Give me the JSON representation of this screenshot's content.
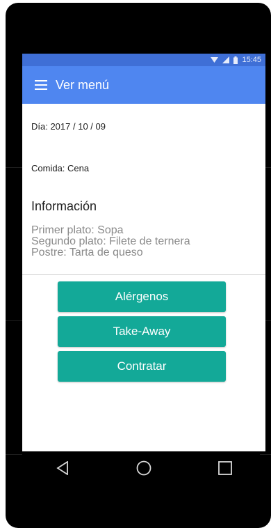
{
  "status": {
    "time": "15:45",
    "wifi_icon": "wifi-icon",
    "signal_icon": "signal-icon",
    "battery_icon": "battery-icon"
  },
  "appbar": {
    "title": "Ver menú",
    "menu_icon": "hamburger-menu-icon"
  },
  "details": {
    "day": "Día: 2017 / 10 / 09",
    "meal": "Comida: Cena"
  },
  "info": {
    "title": "Información",
    "first_course": "Primer plato: Sopa",
    "second_course": "Segundo plato: Filete de ternera",
    "dessert": "Postre: Tarta de queso"
  },
  "buttons": {
    "allergens": "Alérgenos",
    "takeaway": "Take-Away",
    "hire": "Contratar"
  },
  "colors": {
    "statusbar": "#3f6fd6",
    "appbar": "#4f86f0",
    "button": "#13a998"
  },
  "navigation": {
    "back_icon": "back-triangle-icon",
    "home_icon": "home-circle-icon",
    "recents_icon": "recents-square-icon"
  }
}
